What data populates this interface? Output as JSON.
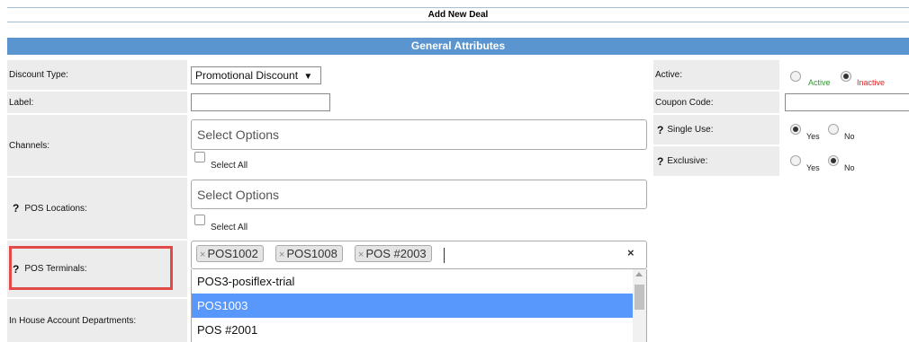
{
  "page": {
    "title": "Add New Deal",
    "section_title": "General Attributes"
  },
  "left_fields": {
    "discount_type": {
      "label": "Discount Type:",
      "value": "Promotional Discount",
      "caret": "▼"
    },
    "label": {
      "label": "Label:",
      "value": ""
    },
    "channels": {
      "label": "Channels:",
      "placeholder": "Select Options",
      "select_all": "Select All"
    },
    "pos_locations": {
      "help": "?",
      "label": "POS Locations:",
      "placeholder": "Select Options",
      "select_all": "Select All"
    },
    "pos_terminals": {
      "help": "?",
      "label": "POS Terminals:",
      "selected": [
        "POS1002",
        "POS1008",
        "POS #2003"
      ],
      "clear": "×",
      "dropdown_options": [
        "POS3-posiflex-trial",
        "POS1003",
        "POS #2001"
      ],
      "highlighted_option": "POS1003"
    },
    "in_house": {
      "label": "In House Account Departments:"
    }
  },
  "right_fields": {
    "active": {
      "label": "Active:",
      "options": [
        "Active",
        "Inactive"
      ],
      "selected": "Inactive",
      "active_color": "#2e9a2e",
      "inactive_color": "#e02020"
    },
    "coupon_code": {
      "label": "Coupon Code:",
      "value": ""
    },
    "single_use": {
      "help": "?",
      "label": "Single Use:",
      "options": [
        "Yes",
        "No"
      ],
      "selected": "Yes"
    },
    "exclusive": {
      "help": "?",
      "label": "Exclusive:",
      "options": [
        "Yes",
        "No"
      ],
      "selected": "No"
    }
  },
  "colors": {
    "section_bar": "#5b95cf",
    "dropdown_highlight": "#5897fb",
    "annotation": "#e24a4a"
  }
}
